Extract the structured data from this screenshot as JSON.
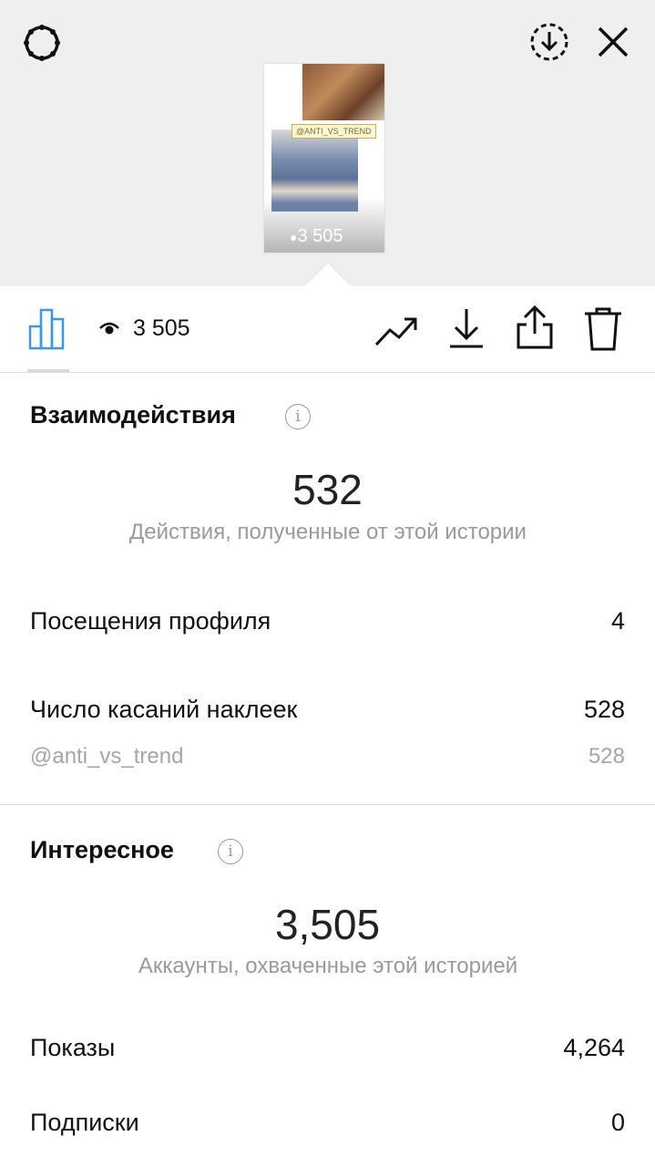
{
  "thumbnail": {
    "tag": "@ANTI_VS_TREND",
    "views_overlay": "3 505"
  },
  "toolbar": {
    "views_count": "3 505"
  },
  "interactions": {
    "title": "Взаимодействия",
    "value": "532",
    "caption": "Действия, полученные от этой истории",
    "rows": [
      {
        "label": "Посещения профиля",
        "value": "4"
      },
      {
        "label": "Число касаний наклеек",
        "value": "528"
      },
      {
        "label": "@anti_vs_trend",
        "value": "528"
      }
    ]
  },
  "discovery": {
    "title": "Интересное",
    "value": "3,505",
    "caption": "Аккаунты, охваченные этой историей",
    "rows": [
      {
        "label": "Показы",
        "value": "4,264"
      },
      {
        "label": "Подписки",
        "value": "0"
      }
    ]
  },
  "colors": {
    "accent": "#3897f0",
    "top_background": "#efefef",
    "muted_text": "#9a9a9a"
  },
  "icons": [
    "settings-icon",
    "download-circle-icon",
    "close-icon",
    "bar-chart-icon",
    "eye-icon",
    "trending-icon",
    "download-icon",
    "share-icon",
    "trash-icon",
    "info-icon"
  ]
}
